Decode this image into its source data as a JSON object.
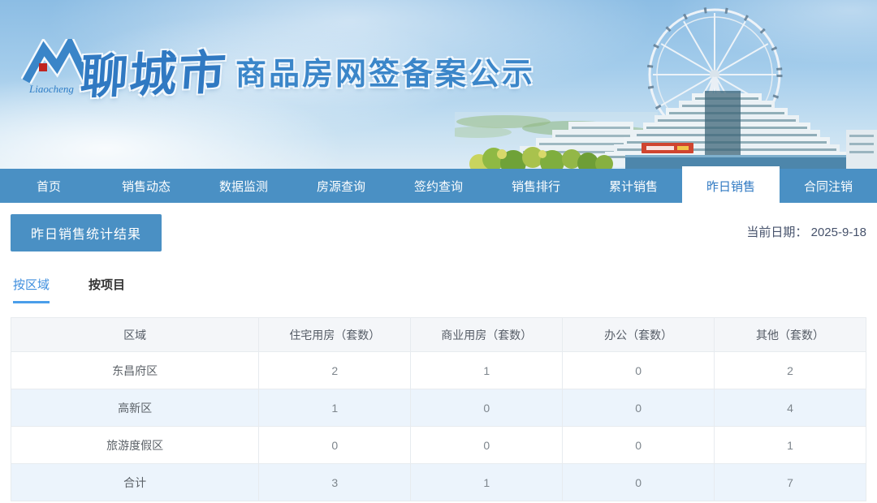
{
  "banner": {
    "logo_script": "Liaocheng",
    "site_name": "聊城市",
    "site_subtitle": "商品房网签备案公示"
  },
  "nav": {
    "items": [
      {
        "label": "首页",
        "active": false
      },
      {
        "label": "销售动态",
        "active": false
      },
      {
        "label": "数据监测",
        "active": false
      },
      {
        "label": "房源查询",
        "active": false
      },
      {
        "label": "签约查询",
        "active": false
      },
      {
        "label": "销售排行",
        "active": false
      },
      {
        "label": "累计销售",
        "active": false
      },
      {
        "label": "昨日销售",
        "active": true
      },
      {
        "label": "合同注销",
        "active": false
      }
    ]
  },
  "page": {
    "title": "昨日销售统计结果",
    "date_label": "当前日期：",
    "date_value": "2025-9-18"
  },
  "tabs": [
    {
      "label": "按区域",
      "active": true
    },
    {
      "label": "按项目",
      "active": false
    }
  ],
  "table": {
    "headers": [
      "区域",
      "住宅用房（套数）",
      "商业用房（套数）",
      "办公（套数）",
      "其他（套数）"
    ],
    "rows": [
      [
        "东昌府区",
        "2",
        "1",
        "0",
        "2"
      ],
      [
        "高新区",
        "1",
        "0",
        "0",
        "4"
      ],
      [
        "旅游度假区",
        "0",
        "0",
        "0",
        "1"
      ],
      [
        "合计",
        "3",
        "1",
        "0",
        "7"
      ]
    ]
  },
  "colors": {
    "accent_blue": "#4a90c4",
    "brand_text_blue": "#3079c2",
    "active_tab_blue": "#3e8ede",
    "tab_underline": "#4a9eea",
    "table_header_bg": "#f4f6f9",
    "table_alt_row_bg": "#ecf4fc",
    "date_text": "#46526b"
  }
}
